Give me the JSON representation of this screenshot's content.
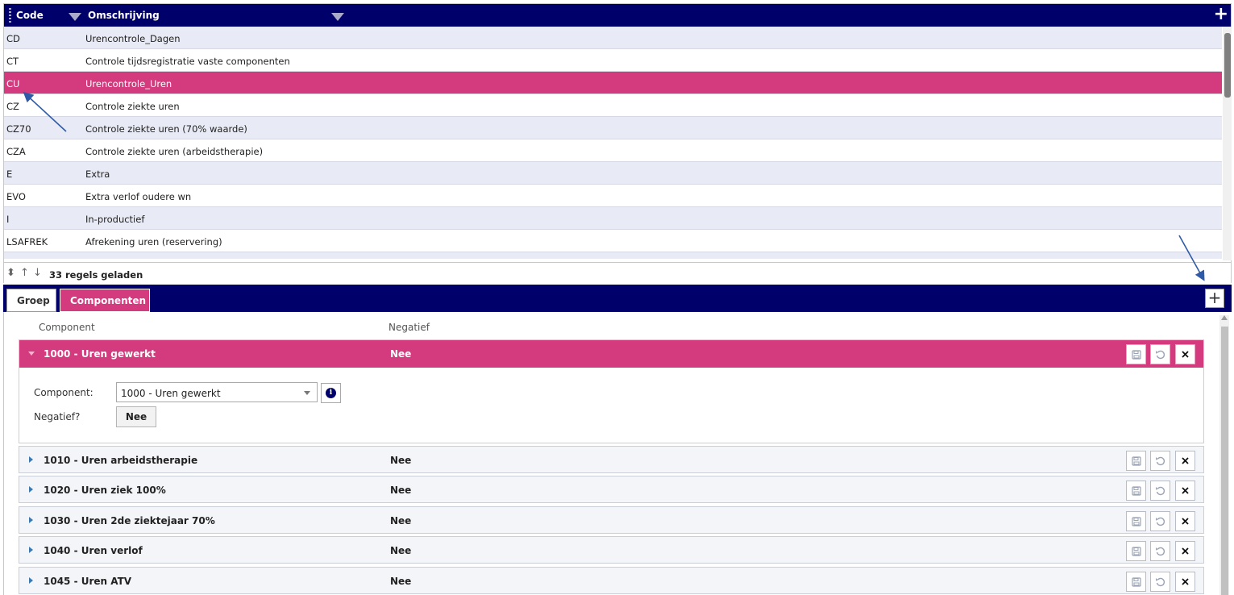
{
  "grid": {
    "columns": {
      "code": "Code",
      "description": "Omschrijving"
    },
    "add_icon": "plus-icon",
    "rows": [
      {
        "code": "CD",
        "desc": "Urencontrole_Dagen"
      },
      {
        "code": "CT",
        "desc": "Controle tijdsregistratie vaste componenten"
      },
      {
        "code": "CU",
        "desc": "Urencontrole_Uren"
      },
      {
        "code": "CZ",
        "desc": "Controle ziekte uren"
      },
      {
        "code": "CZ70",
        "desc": "Controle ziekte uren (70% waarde)"
      },
      {
        "code": "CZA",
        "desc": "Controle ziekte uren (arbeidstherapie)"
      },
      {
        "code": "E",
        "desc": "Extra"
      },
      {
        "code": "EVO",
        "desc": "Extra verlof oudere wn"
      },
      {
        "code": "I",
        "desc": "In-productief"
      },
      {
        "code": "LSAFREK",
        "desc": "Afrekening uren (reservering)"
      }
    ],
    "selected_code": "CU",
    "footer": {
      "count_text": "33 regels geladen"
    }
  },
  "tabs": [
    {
      "label": "Groep",
      "active": false
    },
    {
      "label": "Componenten",
      "active": true
    }
  ],
  "components": {
    "headers": {
      "component": "Component",
      "negative": "Negatief"
    },
    "items": [
      {
        "name": "1000 - Uren gewerkt",
        "negative": "Nee",
        "expanded": true
      },
      {
        "name": "1010 - Uren arbeidstherapie",
        "negative": "Nee",
        "expanded": false
      },
      {
        "name": "1020 - Uren ziek 100%",
        "negative": "Nee",
        "expanded": false
      },
      {
        "name": "1030 - Uren 2de ziektejaar 70%",
        "negative": "Nee",
        "expanded": false
      },
      {
        "name": "1040 - Uren verlof",
        "negative": "Nee",
        "expanded": false
      },
      {
        "name": "1045 - Uren ATV",
        "negative": "Nee",
        "expanded": false
      }
    ],
    "form": {
      "component_label": "Component:",
      "component_value": "1000 - Uren gewerkt",
      "negative_label": "Negatief?",
      "negative_value": "Nee",
      "info_icon": "info-icon"
    }
  },
  "colors": {
    "header_navy": "#00006b",
    "accent_pink": "#d43b7e",
    "row_alt": "#e8ebf5",
    "annotation_arrow": "#2e5aa8"
  }
}
